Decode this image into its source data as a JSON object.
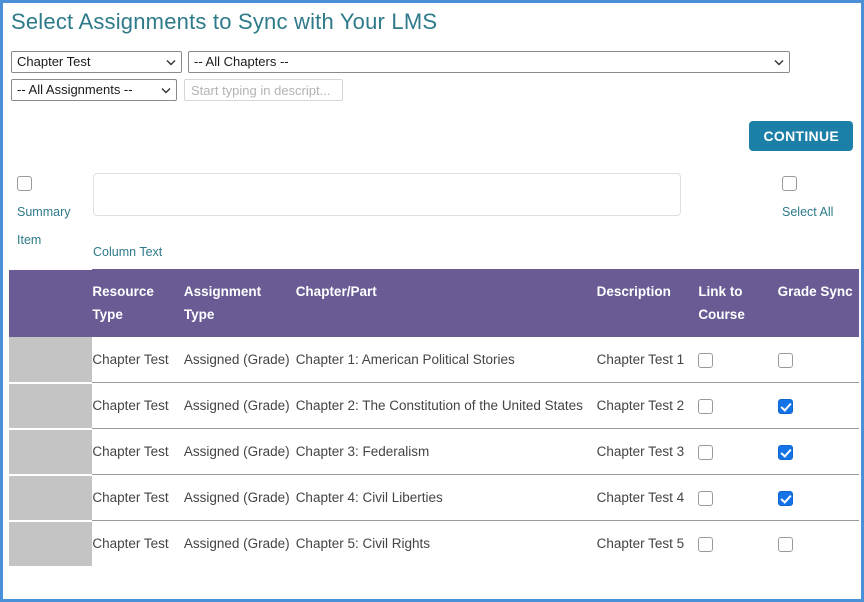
{
  "page": {
    "title": "Select Assignments to Sync with Your LMS",
    "accent_teal": "#2e7a8a",
    "header_purple": "#6b5b95",
    "button_blue": "#1b7fa8",
    "checkbox_blue": "#1473e6",
    "frame_blue": "#4a90d9"
  },
  "filters": {
    "resource_type_value": "Chapter Test",
    "chapter_value": "-- All Chapters --",
    "assignment_value": "-- All Assignments --",
    "search_value": "",
    "search_placeholder": "Start typing in descript..."
  },
  "toolbar": {
    "continue_label": "CONTINUE"
  },
  "summary": {
    "checkbox_checked": false,
    "label_line1": "Summary",
    "label_line2": "Item"
  },
  "column_text": {
    "value": "",
    "label": "Column Text"
  },
  "select_all": {
    "checkbox_checked": false,
    "label": "Select All"
  },
  "table": {
    "headers": {
      "spacer": "",
      "resource_type": "Resource Type",
      "assignment_type": "Assignment Type",
      "chapter_part": "Chapter/Part",
      "description": "Description",
      "link_to_course": "Link to Course",
      "grade_sync": "Grade Sync"
    },
    "rows": [
      {
        "resource_type": "Chapter Test",
        "assignment_type": "Assigned (Grade)",
        "chapter_part": "Chapter 1: American Political Stories",
        "description": "Chapter Test 1",
        "link_to_course": false,
        "grade_sync": false
      },
      {
        "resource_type": "Chapter Test",
        "assignment_type": "Assigned (Grade)",
        "chapter_part": "Chapter 2: The Constitution of the United States",
        "description": "Chapter Test 2",
        "link_to_course": false,
        "grade_sync": true
      },
      {
        "resource_type": "Chapter Test",
        "assignment_type": "Assigned (Grade)",
        "chapter_part": "Chapter 3: Federalism",
        "description": "Chapter Test 3",
        "link_to_course": false,
        "grade_sync": true
      },
      {
        "resource_type": "Chapter Test",
        "assignment_type": "Assigned (Grade)",
        "chapter_part": "Chapter 4: Civil Liberties",
        "description": "Chapter Test 4",
        "link_to_course": false,
        "grade_sync": true
      },
      {
        "resource_type": "Chapter Test",
        "assignment_type": "Assigned (Grade)",
        "chapter_part": "Chapter 5: Civil Rights",
        "description": "Chapter Test 5",
        "link_to_course": false,
        "grade_sync": false
      }
    ]
  }
}
